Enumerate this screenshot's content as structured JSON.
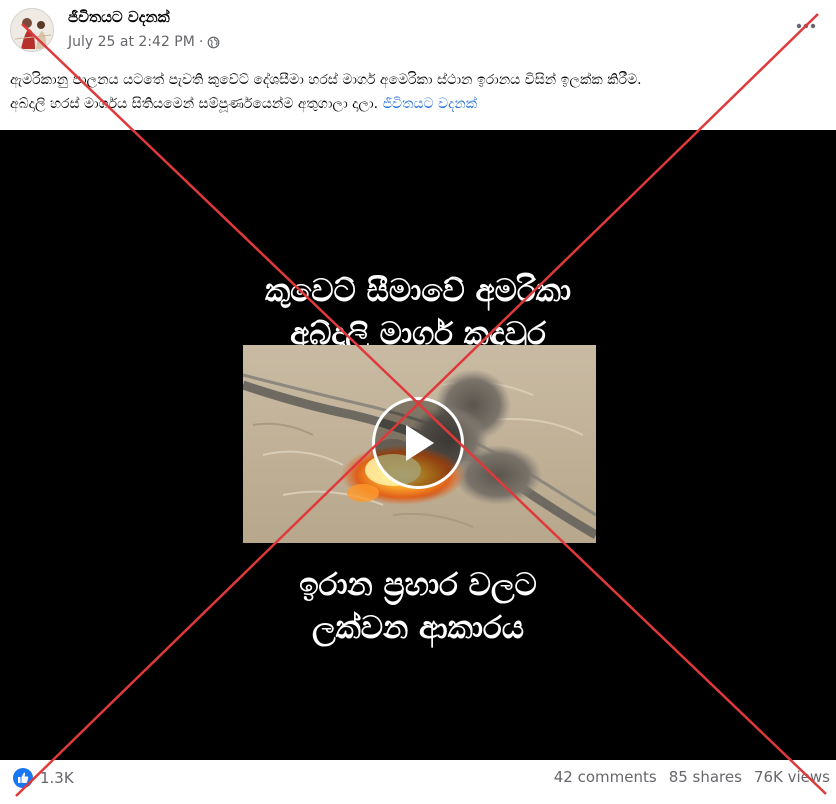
{
  "post": {
    "author": "ජීවිතයට වදනක්",
    "timestamp": "July 25 at 2:42 PM",
    "separator": "·",
    "audience_icon": "globe-icon",
    "more_icon": "more-options-icon",
    "caption_line1": "ඇමරිකානු පාලනය යටතේ පැවති කුවේට් දේශසීමා හරස් මාර්ග අමෙරිකා ස්ථාන ඉරානය විසින් ඉලක්ක කිරීම.",
    "caption_line2": "අබ්දාලි හරස් මාර්ගය සිතියමෙන් සම්පූර්ණයෙන්ම අතුගාලා දාලා.",
    "caption_tag": "ජීවිතයට වදනක්"
  },
  "video": {
    "overlay_top_line1": "කුවෙට් සීමාවේ අමරිකා",
    "overlay_top_line2": "අබ්දාලි මාර්ග කඳවුර",
    "overlay_bottom_line1": "ඉරාන ප්‍රහාර වලට",
    "overlay_bottom_line2": "ලක්වන ආකාරය",
    "play_icon": "play-icon"
  },
  "engagement": {
    "reaction_icon": "like-icon",
    "reaction_count": "1.3K",
    "comments": "42 comments",
    "shares": "85 shares",
    "views": "76K views"
  },
  "colors": {
    "cross": "#e0393b",
    "link": "#216fdb",
    "meta": "#65676b",
    "like": "#1877f2"
  }
}
